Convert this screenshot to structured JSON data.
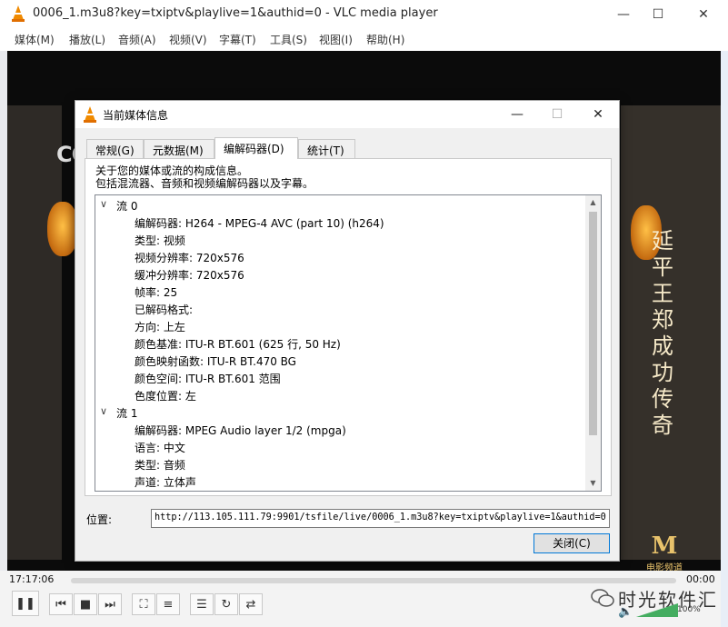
{
  "window": {
    "title": "0006_1.m3u8?key=txiptv&playlive=1&authid=0 - VLC media player"
  },
  "menu": [
    "媒体(M)",
    "播放(L)",
    "音频(A)",
    "视频(V)",
    "字幕(T)",
    "工具(S)",
    "视图(I)",
    "帮助(H)"
  ],
  "video": {
    "title_chars": [
      "延",
      "平",
      "王",
      "郑",
      "成",
      "功",
      "传",
      "奇"
    ],
    "channel_logo": "CCTV",
    "channel_badge_big": "M",
    "channel_badge_text": "电影频道"
  },
  "dialog": {
    "title": "当前媒体信息",
    "tabs": [
      "常规(G)",
      "元数据(M)",
      "编解码器(D)",
      "统计(T)"
    ],
    "active_tab": 2,
    "description_line1": "关于您的媒体或流的构成信息。",
    "description_line2": "包括混流器、音频和视频编解码器以及字幕。",
    "stream0": {
      "label": "流 0",
      "rows": [
        "编解码器: H264 - MPEG-4 AVC (part 10) (h264)",
        "类型: 视频",
        "视频分辨率: 720x576",
        "缓冲分辨率: 720x576",
        "帧率: 25",
        "已解码格式:",
        "方向: 上左",
        "颜色基准: ITU-R BT.601 (625 行, 50 Hz)",
        "颜色映射函数: ITU-R BT.470 BG",
        "颜色空间: ITU-R BT.601 范围",
        "色度位置: 左"
      ]
    },
    "stream1": {
      "label": "流 1",
      "rows": [
        "编解码器: MPEG Audio layer 1/2 (mpga)",
        "语言: 中文",
        "类型: 音频",
        "声道: 立体声"
      ]
    },
    "location_label": "位置:",
    "location_value": "http://113.105.111.79:9901/tsfile/live/0006_1.m3u8?key=txiptv&playlive=1&authid=0",
    "close_label": "关闭(C)"
  },
  "player": {
    "elapsed": "17:17:06",
    "remaining": "00:00",
    "volume_label": "100%",
    "progress": 0,
    "volume": 1.0
  },
  "watermark": "时光软件汇",
  "colors": {
    "vlc_orange": "#f08a00",
    "accent": "#0078d7",
    "title_text": "#f6e9c8"
  }
}
